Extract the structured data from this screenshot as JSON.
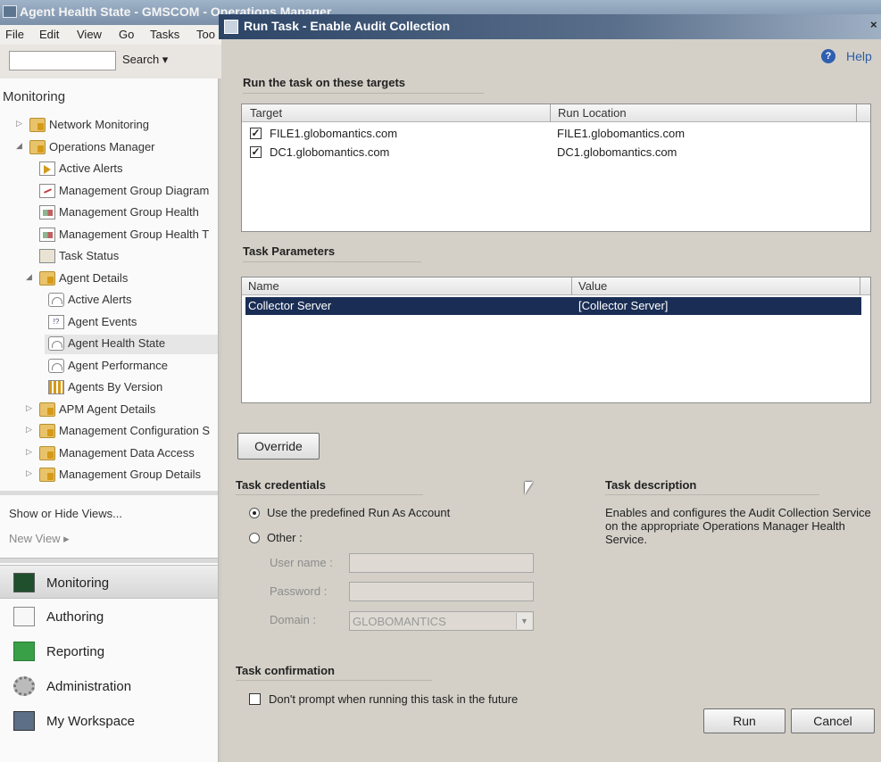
{
  "main_window": {
    "title": "Agent Health State - GMSCOM - Operations Manager",
    "menu": [
      "File",
      "Edit",
      "View",
      "Go",
      "Tasks",
      "Too"
    ],
    "search_button": "Search ▾"
  },
  "navigation": {
    "header": "Monitoring",
    "tree": [
      {
        "label": "Network Monitoring",
        "icon": "folder-icon"
      },
      {
        "label": "Operations Manager",
        "icon": "folder-icon"
      },
      {
        "label": "Active Alerts",
        "icon": "alert-view-icon"
      },
      {
        "label": "Management Group Diagram",
        "icon": "diagram-view-icon"
      },
      {
        "label": "Management Group Health",
        "icon": "health-view-icon"
      },
      {
        "label": "Management Group Health T",
        "icon": "health-view-icon"
      },
      {
        "label": "Task Status",
        "icon": "task-status-icon"
      },
      {
        "label": "Agent Details",
        "icon": "folder-icon"
      },
      {
        "label": "Active Alerts",
        "icon": "alert-view-icon"
      },
      {
        "label": "Agent Events",
        "icon": "events-view-icon"
      },
      {
        "label": "Agent Health State",
        "icon": "state-view-icon"
      },
      {
        "label": "Agent Performance",
        "icon": "performance-view-icon"
      },
      {
        "label": "Agents By Version",
        "icon": "grid-view-icon"
      },
      {
        "label": "APM Agent Details",
        "icon": "folder-icon"
      },
      {
        "label": "Management Configuration S",
        "icon": "folder-icon"
      },
      {
        "label": "Management Data Access",
        "icon": "folder-icon"
      },
      {
        "label": "Management Group Details",
        "icon": "folder-icon"
      }
    ],
    "show_hide": "Show or Hide Views...",
    "new_view": "New View ▸"
  },
  "wunderbar": [
    {
      "label": "Monitoring",
      "icon": "monitoring-icon"
    },
    {
      "label": "Authoring",
      "icon": "authoring-icon"
    },
    {
      "label": "Reporting",
      "icon": "reporting-icon"
    },
    {
      "label": "Administration",
      "icon": "administration-icon"
    },
    {
      "label": "My Workspace",
      "icon": "my-workspace-icon"
    }
  ],
  "dialog": {
    "title": "Run Task - Enable Audit Collection",
    "close": "×",
    "help": "Help",
    "targets": {
      "heading": "Run the task on these targets",
      "columns": [
        "Target",
        "Run Location"
      ],
      "rows": [
        {
          "checked": true,
          "target": "FILE1.globomantics.com",
          "location": "FILE1.globomantics.com"
        },
        {
          "checked": true,
          "target": "DC1.globomantics.com",
          "location": "DC1.globomantics.com"
        }
      ]
    },
    "parameters": {
      "heading": "Task Parameters",
      "columns": [
        "Name",
        "Value"
      ],
      "rows": [
        {
          "name": "Collector Server",
          "value": "[Collector Server]"
        }
      ]
    },
    "override_button": "Override",
    "credentials": {
      "heading": "Task credentials",
      "option_predefined": "Use the predefined Run As Account",
      "option_other": "Other :",
      "selected": "predefined",
      "username_label": "User name :",
      "password_label": "Password :",
      "domain_label": "Domain :",
      "domain_value": "GLOBOMANTICS"
    },
    "description": {
      "heading": "Task description",
      "text": "Enables and configures the Audit Collection Service on the appropriate Operations Manager Health Service."
    },
    "confirmation": {
      "heading": "Task confirmation",
      "dont_prompt": "Don't prompt when running this task in the future",
      "checked": false
    },
    "run_button": "Run",
    "cancel_button": "Cancel"
  }
}
